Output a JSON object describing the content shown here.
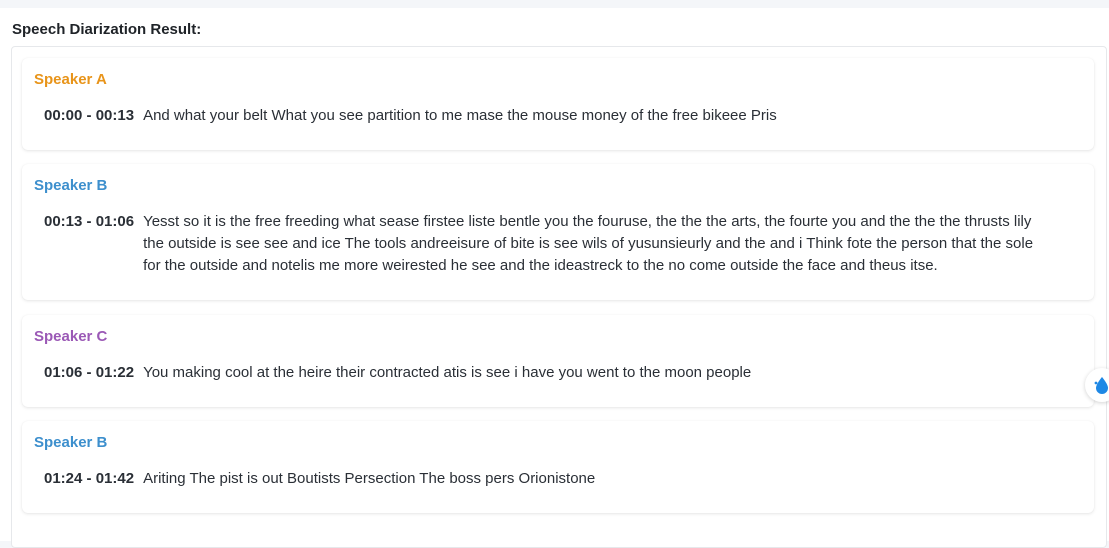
{
  "header": {
    "title": "Speech Diarization Result:"
  },
  "colors": {
    "speaker_a": "#e8941a",
    "speaker_b": "#3d8fcd",
    "speaker_c": "#9b59b6"
  },
  "results": [
    {
      "speaker": "Speaker A",
      "time": "00:00 - 00:13",
      "text": "And what your belt What you see partition to me mase the mouse money of the free bikeee Pris"
    },
    {
      "speaker": "Speaker B",
      "time": "00:13 - 01:06",
      "text": "Yesst so it is the free freeding what sease firstee liste bentle you the fouruse, the the the arts, the fourte you and the the the thrusts lily the outside is see see and ice The tools andreeisure of bite is see wils of yusunsieurly and the and i Think fote the person that the sole for the outside and notelis me more weirested he see and the ideastreck to the no come outside the face and theus itse."
    },
    {
      "speaker": "Speaker C",
      "time": "01:06 - 01:22",
      "text": "You making cool at the heire their contracted atis is see i have you went to the moon people"
    },
    {
      "speaker": "Speaker B",
      "time": "01:24 - 01:42",
      "text": "Ariting The pist is out Boutists Persection The boss pers Orionistone"
    }
  ],
  "side_button": {
    "icon": "droplet-icon"
  }
}
